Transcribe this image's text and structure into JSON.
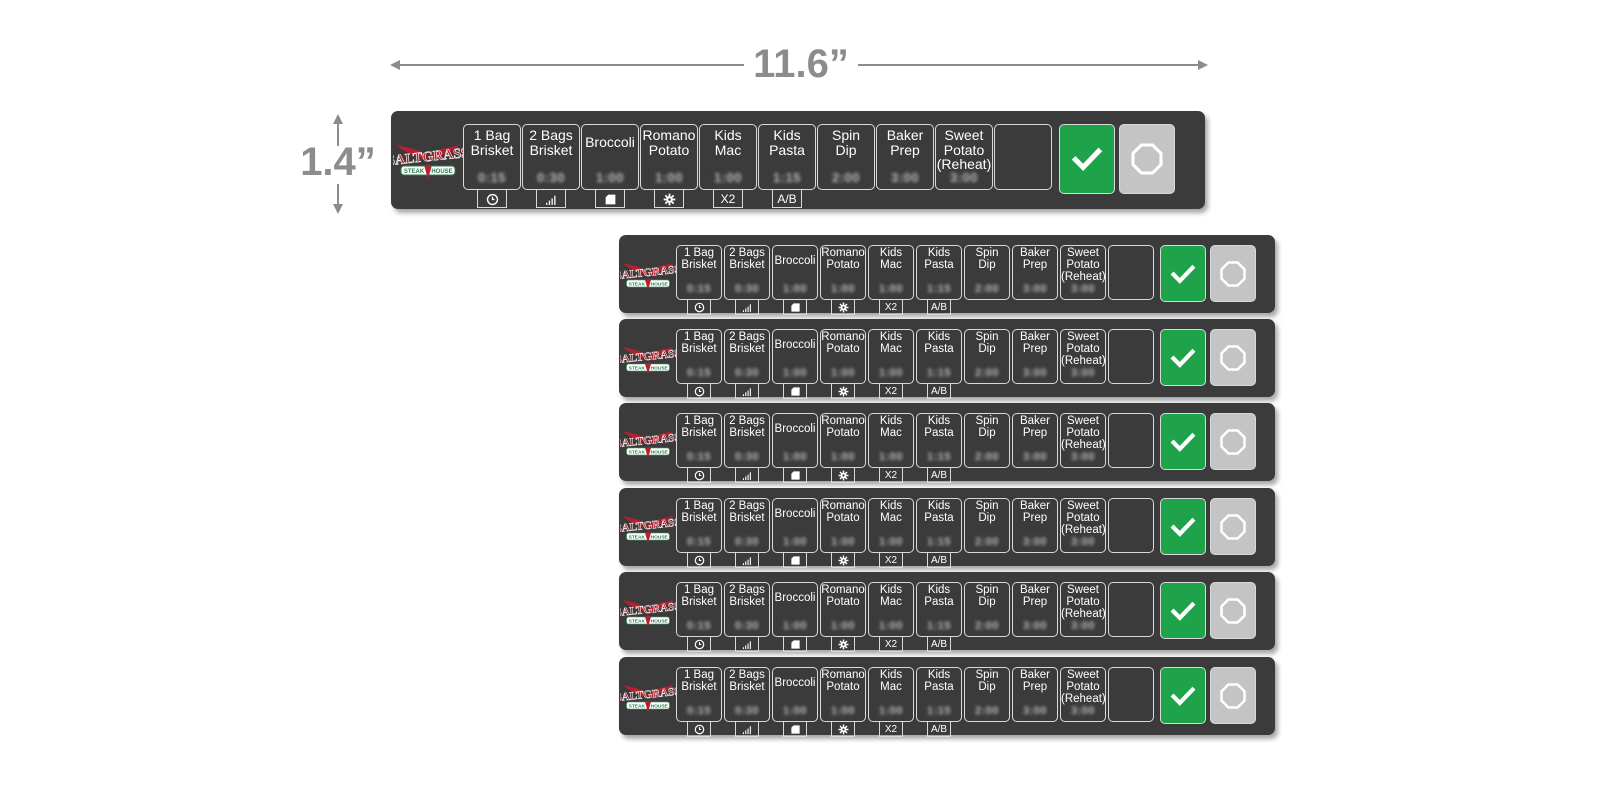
{
  "dimensions": {
    "width": "11.6”",
    "height": "1.4”"
  },
  "logo": {
    "brand": "SALTGRASS",
    "sub_left": "STEAK",
    "sub_right": "HOUSE"
  },
  "colors": {
    "panel": "#3b3b3b",
    "confirm": "#1ea34a",
    "stop": "#c4c4c4",
    "logo_red": "#b5202e",
    "logo_green": "#2f7a4f"
  },
  "items": [
    {
      "label": "1 Bag\nBrisket",
      "value": "0:15",
      "icon": "clock-icon",
      "icon_text": ""
    },
    {
      "label": "2 Bags\nBrisket",
      "value": "0:30",
      "icon": "signal-icon",
      "icon_text": ""
    },
    {
      "label": "Broccoli",
      "value": "1:00",
      "icon": "folder-icon",
      "icon_text": ""
    },
    {
      "label": "Romano\nPotato",
      "value": "1:00",
      "icon": "gear-icon",
      "icon_text": ""
    },
    {
      "label": "Kids\nMac",
      "value": "1:00",
      "icon": "x2",
      "icon_text": "X2"
    },
    {
      "label": "Kids\nPasta",
      "value": "1:15",
      "icon": "ab",
      "icon_text": "A/B"
    },
    {
      "label": "Spin\nDip",
      "value": "2:00",
      "icon": "",
      "icon_text": ""
    },
    {
      "label": "Baker\nPrep",
      "value": "3:00",
      "icon": "",
      "icon_text": ""
    },
    {
      "label": "Sweet\nPotato\n(Reheat)",
      "value": "3:00",
      "icon": "",
      "icon_text": ""
    },
    {
      "label": "",
      "value": "",
      "icon": "",
      "icon_text": ""
    }
  ],
  "actions": {
    "confirm_icon": "check-icon",
    "stop_icon": "octagon-icon"
  }
}
